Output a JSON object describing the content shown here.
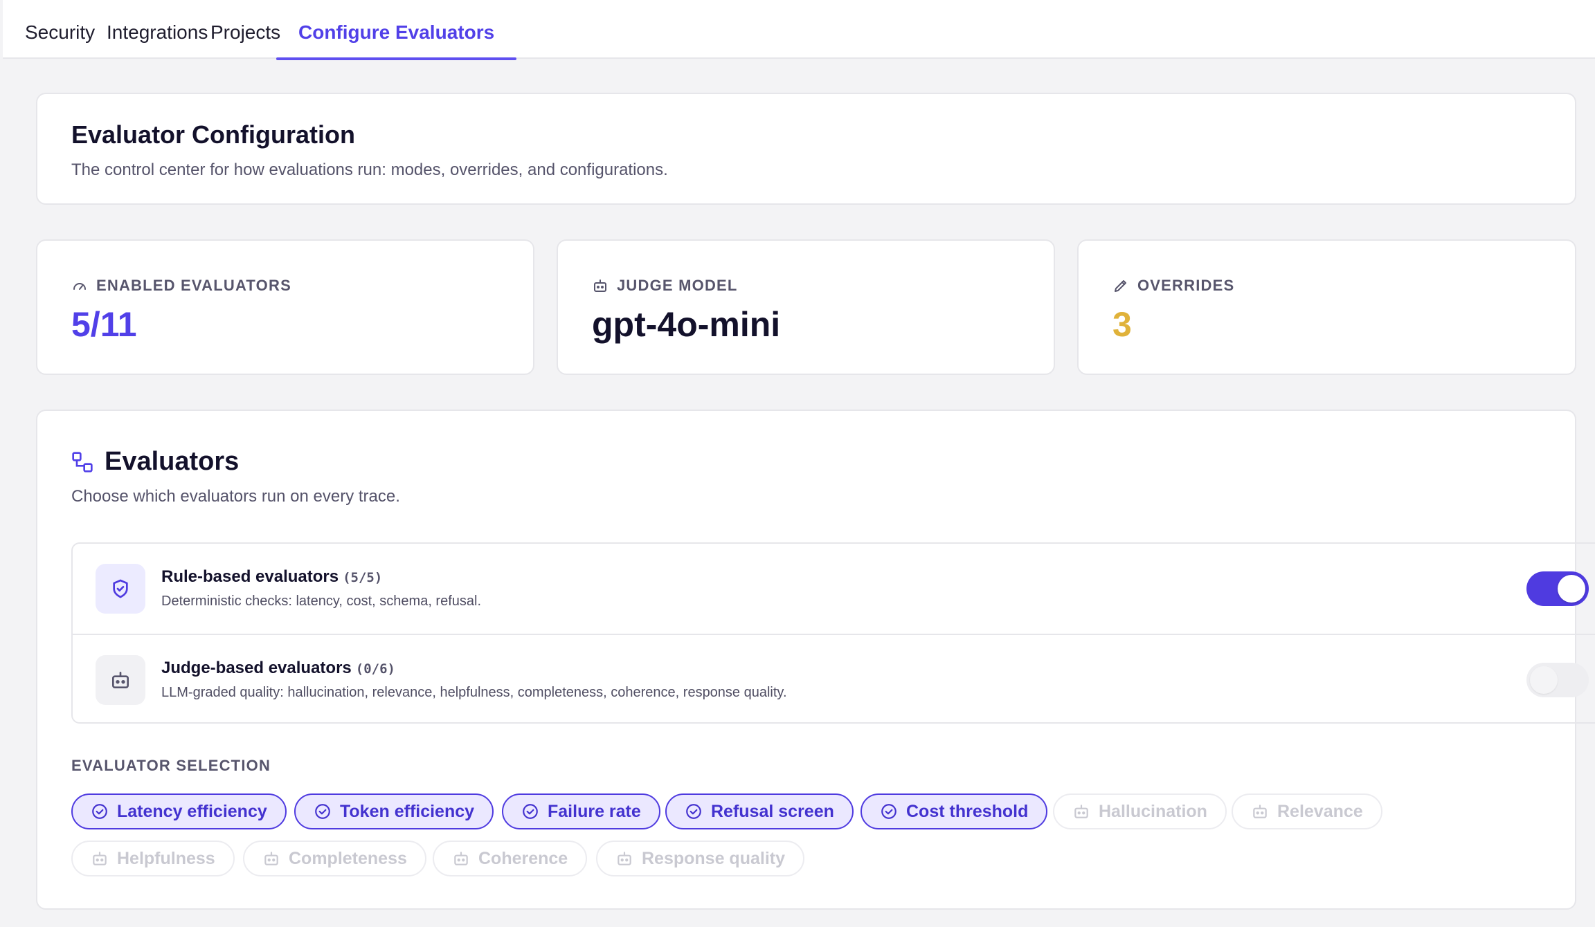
{
  "colors": {
    "accent": "#5140e8",
    "amber": "#e0b23a",
    "text": "#13112b"
  },
  "tabs": [
    {
      "label": "Security",
      "active": false
    },
    {
      "label": "Integrations",
      "active": false
    },
    {
      "label": "Projects",
      "active": false
    },
    {
      "label": "Configure Evaluators",
      "active": true
    }
  ],
  "header": {
    "title": "Evaluator Configuration",
    "subtitle": "The control center for how evaluations run: modes, overrides, and configurations."
  },
  "stats": [
    {
      "label": "ENABLED EVALUATORS",
      "icon": "gauge-icon",
      "value": "5/11",
      "color": "#5140e8"
    },
    {
      "label": "JUDGE MODEL",
      "icon": "robot-icon",
      "value": "gpt-4o-mini",
      "color": "#13112b"
    },
    {
      "label": "OVERRIDES",
      "icon": "pencil-icon",
      "value": "3",
      "color": "#e0b23a"
    }
  ],
  "evaluators": {
    "title": "Evaluators",
    "subtitle": "Choose which evaluators run on every trace.",
    "groups": [
      {
        "title": "Rule-based evaluators",
        "count": "(5/5)",
        "description": "Deterministic checks: latency, cost, schema, refusal.",
        "icon": "shield-check-icon",
        "enabled": true
      },
      {
        "title": "Judge-based evaluators",
        "count": "(0/6)",
        "description": "LLM-graded quality: hallucination, relevance, helpfulness, completeness, coherence, response quality.",
        "icon": "robot-icon",
        "enabled": false
      }
    ],
    "selection_label": "EVALUATOR SELECTION",
    "chips": [
      {
        "label": "Latency efficiency",
        "enabled": true
      },
      {
        "label": "Token efficiency",
        "enabled": true
      },
      {
        "label": "Failure rate",
        "enabled": true
      },
      {
        "label": "Refusal screen",
        "enabled": true
      },
      {
        "label": "Cost threshold",
        "enabled": true
      },
      {
        "label": "Hallucination",
        "enabled": false
      },
      {
        "label": "Relevance",
        "enabled": false
      },
      {
        "label": "Helpfulness",
        "enabled": false
      },
      {
        "label": "Completeness",
        "enabled": false
      },
      {
        "label": "Coherence",
        "enabled": false
      },
      {
        "label": "Response quality",
        "enabled": false
      }
    ]
  }
}
